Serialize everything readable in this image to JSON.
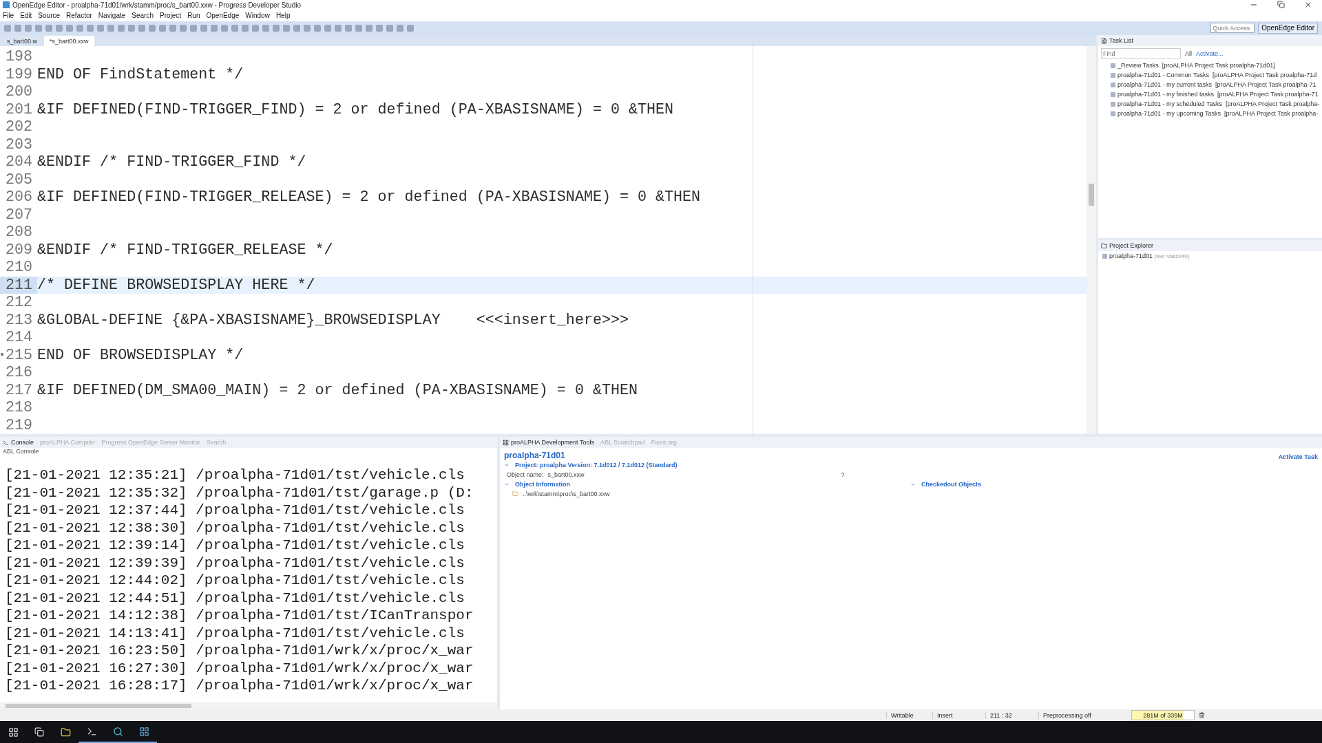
{
  "window": {
    "title": "OpenEdge Editor - proalpha-71d01/wrk/stamm/proc/s_bart00.xxw - Progress Developer Studio"
  },
  "menu": [
    "File",
    "Edit",
    "Source",
    "Refactor",
    "Navigate",
    "Search",
    "Project",
    "Run",
    "OpenEdge",
    "Window",
    "Help"
  ],
  "quick_access": {
    "placeholder": "Quick Access"
  },
  "perspective": "OpenEdge Editor",
  "editor_tabs": [
    {
      "label": "s_bart00.w",
      "selected": false
    },
    {
      "label": "*s_bart00.xxw",
      "selected": true
    }
  ],
  "code": [
    {
      "number": "198",
      "current": false,
      "changed": false
    },
    {
      "number": "199",
      "text": "END OF FindStatement */",
      "current": false,
      "changed": false
    },
    {
      "number": "200",
      "current": false,
      "changed": false
    },
    {
      "number": "201",
      "text": "&IF DEFINED(FIND-TRIGGER_FIND) = 2 or defined (PA-XBASISNAME) = 0 &THEN",
      "current": false,
      "changed": false
    },
    {
      "number": "202",
      "current": false,
      "changed": false
    },
    {
      "number": "203",
      "current": false,
      "changed": false
    },
    {
      "number": "204",
      "text": "&ENDIF /* FIND-TRIGGER_FIND */",
      "current": false,
      "changed": false
    },
    {
      "number": "205",
      "current": false,
      "changed": false
    },
    {
      "number": "206",
      "text": "&IF DEFINED(FIND-TRIGGER_RELEASE) = 2 or defined (PA-XBASISNAME) = 0 &THEN",
      "current": false,
      "changed": false
    },
    {
      "number": "207",
      "current": false,
      "changed": false
    },
    {
      "number": "208",
      "current": false,
      "changed": false
    },
    {
      "number": "209",
      "text": "&ENDIF /* FIND-TRIGGER_RELEASE */",
      "current": false,
      "changed": false
    },
    {
      "number": "210",
      "current": false,
      "changed": false
    },
    {
      "number": "211",
      "text": "/* DEFINE BROWSEDISPLAY HERE */",
      "current": true,
      "changed": false
    },
    {
      "number": "212",
      "current": false,
      "changed": false
    },
    {
      "number": "213",
      "text": "&GLOBAL-DEFINE {&PA-XBASISNAME}_BROWSEDISPLAY    <<<insert_here>>>",
      "current": false,
      "changed": false
    },
    {
      "number": "214",
      "current": false,
      "changed": false
    },
    {
      "number": "215",
      "text": "END OF BROWSEDISPLAY */",
      "current": false,
      "changed": true
    },
    {
      "number": "216",
      "current": false,
      "changed": false
    },
    {
      "number": "217",
      "text": "&IF DEFINED(DM_SMA00_MAIN) = 2 or defined (PA-XBASISNAME) = 0 &THEN",
      "current": false,
      "changed": false
    },
    {
      "number": "218",
      "current": false,
      "changed": false
    },
    {
      "number": "219",
      "current": false,
      "changed": false
    }
  ],
  "task_list": {
    "title": "Task List",
    "find": {
      "placeholder": "Find"
    },
    "filter": "All",
    "activate": "Activate...",
    "tasks": [
      "_Review Tasks  [proALPHA Project Task proalpha-71d01]",
      "proalpha-71d01 - Common Tasks  [proALPHA Project Task proalpha-71d",
      "proalpha-71d01 - my current tasks  [proALPHA Project Task proalpha-71",
      "proalpha-71d01 - my finished tasks  [proALPHA Project Task proalpha-71",
      "proalpha-71d01 - my scheduled Tasks  [proALPHA Project Task proalpha-",
      "proalpha-71d01 - my upcoming Tasks  [proALPHA Project Task proalpha-"
    ]
  },
  "project_explorer": {
    "title": "Project Explorer",
    "items": [
      {
        "label": "proalpha-71d01",
        "note": "[wer-vasz040]"
      }
    ]
  },
  "console": {
    "tabs": [
      {
        "label": "Console",
        "selected": true
      },
      {
        "label": "proALPHA Compiler",
        "selected": false
      },
      {
        "label": "Progress OpenEdge Server Monitor",
        "selected": false
      },
      {
        "label": "Search",
        "selected": false
      }
    ],
    "subtitle": "ABL Console",
    "lines": [
      "[21-01-2021 12:35:21] /proalpha-71d01/tst/vehicle.cls",
      "[21-01-2021 12:35:32] /proalpha-71d01/tst/garage.p (D:",
      "[21-01-2021 12:37:44] /proalpha-71d01/tst/vehicle.cls",
      "[21-01-2021 12:38:30] /proalpha-71d01/tst/vehicle.cls",
      "[21-01-2021 12:39:14] /proalpha-71d01/tst/vehicle.cls",
      "[21-01-2021 12:39:39] /proalpha-71d01/tst/vehicle.cls",
      "[21-01-2021 12:44:02] /proalpha-71d01/tst/vehicle.cls",
      "[21-01-2021 12:44:51] /proalpha-71d01/tst/vehicle.cls",
      "[21-01-2021 14:12:38] /proalpha-71d01/tst/ICanTranspor",
      "[21-01-2021 14:13:41] /proalpha-71d01/tst/vehicle.cls",
      "[21-01-2021 16:23:50] /proalpha-71d01/wrk/x/proc/x_war",
      "[21-01-2021 16:27:30] /proalpha-71d01/wrk/x/proc/x_war",
      "[21-01-2021 16:28:17] /proalpha-71d01/wrk/x/proc/x_war"
    ]
  },
  "dev_tools": {
    "tabs": [
      {
        "label": "proALPHA Development Tools",
        "selected": true
      },
      {
        "label": "ABL Scratchpad",
        "selected": false
      },
      {
        "label": "Fixes.org",
        "selected": false
      }
    ],
    "project": "proalpha-71d01",
    "activate_task": "Activate Task",
    "project_section": "Project: proalpha Version: 7.1d012 / 7.1d012 (Standard)",
    "object_label": "Object name:",
    "object_value": "s_bart00.xxw",
    "object_hint": "?",
    "object_info": "Object Information",
    "checkedout": "Checkedout Objects",
    "object_path": "..\\wrk\\stamm\\proc\\s_bart00.xxw"
  },
  "status_bar": {
    "mode": "Writable",
    "insert": "Insert",
    "position": "211 : 32",
    "preprocessing": "Preprocessing off",
    "memory": {
      "text": "281M of 339M",
      "level": 0.83
    }
  }
}
